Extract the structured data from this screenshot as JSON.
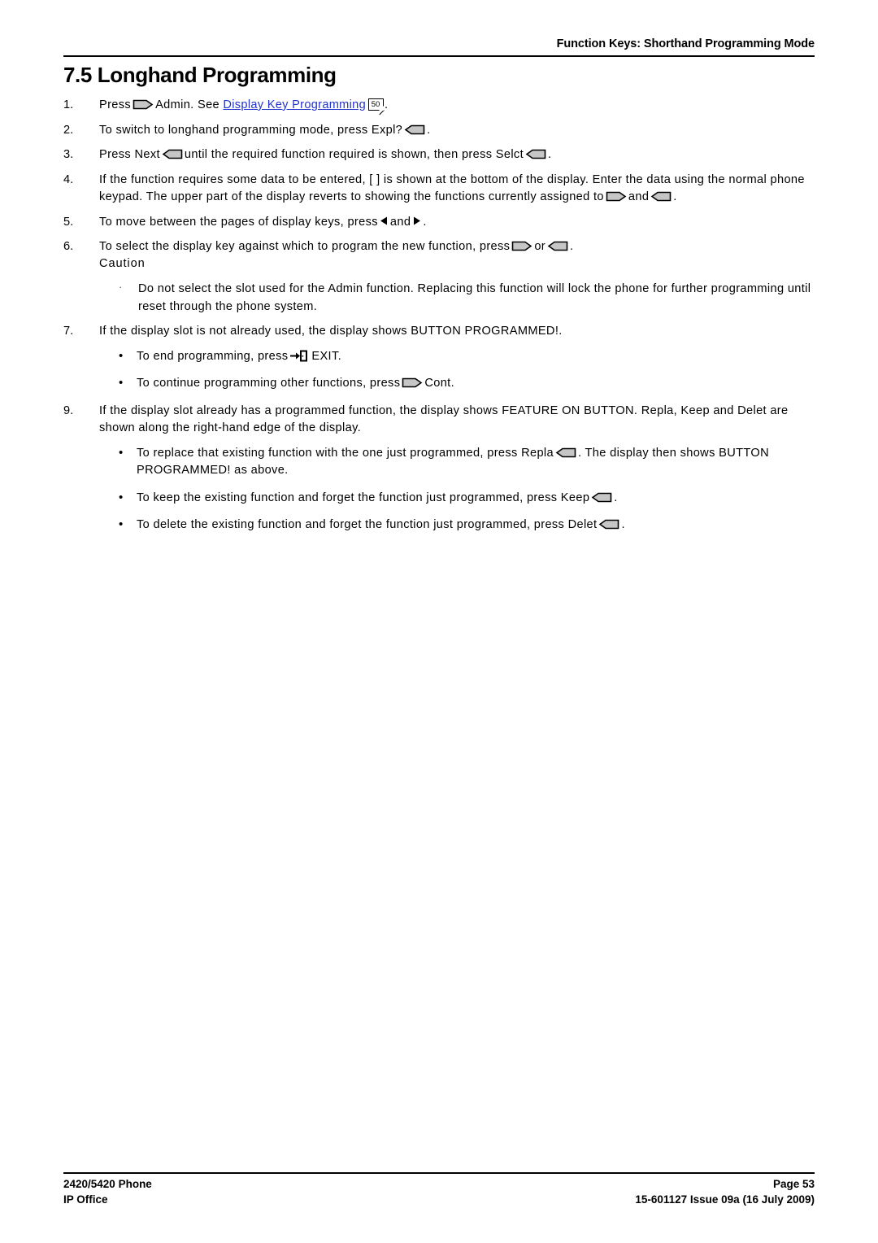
{
  "header": {
    "title": "Function Keys: Shorthand Programming Mode"
  },
  "page_title": "7.5 Longhand Programming",
  "steps": {
    "s1": {
      "number": "1.",
      "text_before": "Press",
      "text_mid": "Admin. See",
      "link_text": "Display Key Programming",
      "page_ref": "50",
      "text_after": "."
    },
    "s2": {
      "number": "2.",
      "text_before": "To switch to longhand programming mode, press Expl?",
      "text_after": "."
    },
    "s3": {
      "number": "3.",
      "text_before": "Press Next",
      "text_mid": "until the required function required is shown, then press Selct",
      "text_after": "."
    },
    "s4": {
      "number": "4.",
      "text_before": "If the function requires some data to be entered, [ ] is shown at the bottom of the display. Enter the data using the normal phone keypad. The upper part of the display reverts to showing the functions currently assigned to",
      "text_mid": "and",
      "text_after": "."
    },
    "s5": {
      "number": "5.",
      "text_before": "To move between the pages of display keys, press",
      "text_mid": "and",
      "text_after": "."
    },
    "s6": {
      "number": "6.",
      "text_before": "To select the display key against which to program the new function, press",
      "text_mid": "or",
      "text_after": ".",
      "caution_heading": "Caution",
      "caution_bullet": "·",
      "caution_text": "Do not select the slot used for the Admin function. Replacing this function will lock the phone for further programming until reset through the phone system."
    },
    "s7": {
      "number": "7.",
      "text": "If the display slot is not already used, the display shows BUTTON PROGRAMMED!.",
      "bullets": {
        "b1": {
          "marker": "•",
          "text_before": "To end programming, press",
          "text_after": "EXIT."
        },
        "b2": {
          "marker": "•",
          "text_before": "To continue programming other functions, press",
          "text_after": "Cont."
        }
      }
    },
    "s9": {
      "number": "9.",
      "text": "If the display slot already has a programmed function, the display shows FEATURE ON BUTTON. Repla, Keep and Delet are shown along the right-hand edge of the display.",
      "bullets": {
        "b1": {
          "marker": "•",
          "text_before": "To replace that existing function with the one just programmed, press Repla",
          "text_after": ". The display then shows BUTTON PROGRAMMED! as above."
        },
        "b2": {
          "marker": "•",
          "text_before": "To keep the existing function and forget the function just programmed, press Keep",
          "text_after": "."
        },
        "b3": {
          "marker": "•",
          "text_before": "To delete the existing function and forget the function just programmed, press Delet",
          "text_after": "."
        }
      }
    }
  },
  "icons": {
    "key_right": "display-key-right-icon",
    "key_left": "display-key-left-icon",
    "arrow_left": "page-left-arrow-icon",
    "arrow_right": "page-right-arrow-icon",
    "exit": "exit-door-icon"
  },
  "colors": {
    "link": "#2233cc",
    "key_fill": "#c6c6c6",
    "key_outline": "#000000",
    "text": "#000000",
    "rule": "#000000"
  },
  "footer": {
    "left_line1": "2420/5420 Phone",
    "left_line2": "IP Office",
    "right_line1": "Page 53",
    "right_line2": "15-601127 Issue 09a (16 July 2009)"
  }
}
